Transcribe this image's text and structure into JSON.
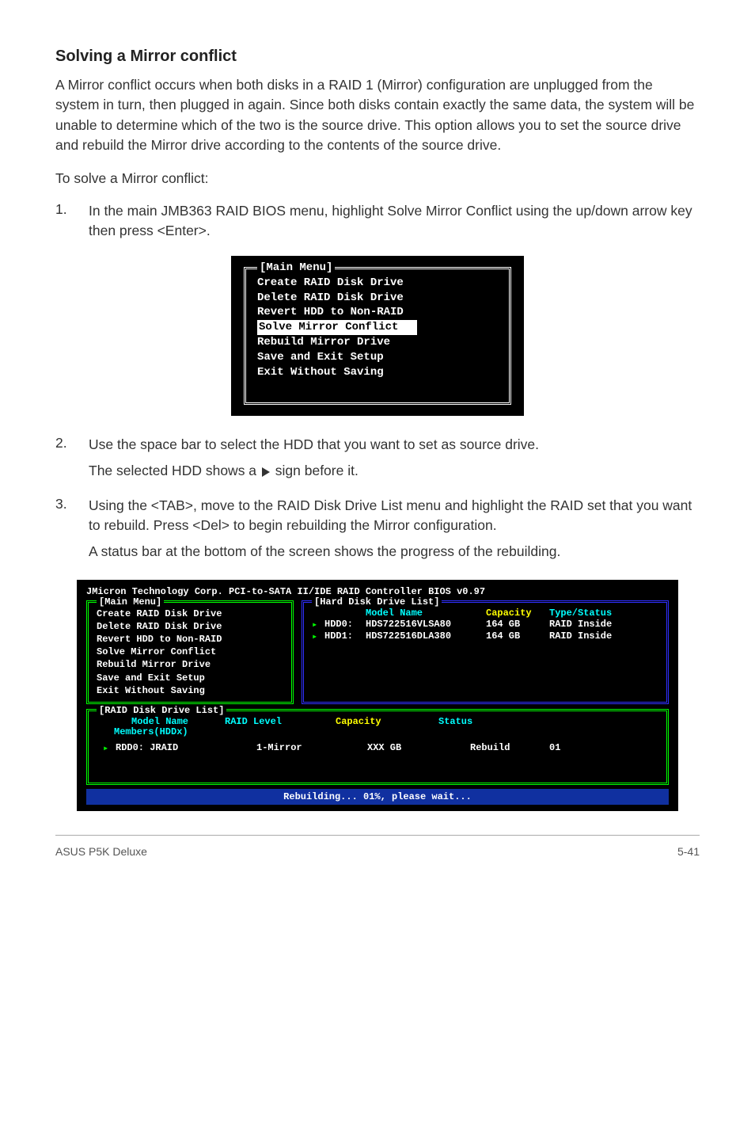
{
  "heading": "Solving a Mirror conflict",
  "para1": "A Mirror conflict occurs when both disks in a RAID 1 (Mirror) configuration are unplugged from the system in turn, then plugged in again. Since both disks contain exactly the same data, the system will be unable to determine which of the two is the source drive. This option allows you to set the source drive and rebuild the Mirror drive according to the contents of the source drive.",
  "para2": "To solve a Mirror conflict:",
  "step1_num": "1.",
  "step1_text": "In the main JMB363 RAID BIOS menu, highlight Solve Mirror Conflict using the up/down arrow key then press <Enter>.",
  "bios_small": {
    "title": "[Main Menu]",
    "items": [
      "Create RAID Disk Drive",
      "Delete RAID Disk Drive",
      "Revert HDD to Non-RAID",
      "Solve Mirror Conflict",
      "Rebuild Mirror Drive",
      "Save and Exit Setup",
      "Exit Without Saving"
    ],
    "highlight_index": 3
  },
  "step2_num": "2.",
  "step2_text": "Use the space bar to select the HDD that you want to set as source drive.",
  "step2_sub_before": "The selected HDD shows a ",
  "step2_sub_after": " sign before it.",
  "step3_num": "3.",
  "step3_text": "Using the <TAB>, move to the RAID Disk Drive List menu and highlight the RAID set that you want to rebuild. Press <Del> to begin rebuilding the Mirror configuration.",
  "step3_sub": "A status bar at the bottom of the screen shows the progress of the rebuilding.",
  "bios_large": {
    "header": "JMicron Technology Corp. PCI-to-SATA II/IDE RAID Controller BIOS v0.97",
    "main_menu_title": "[Main Menu]",
    "main_menu_items": [
      "Create RAID Disk Drive",
      "Delete RAID Disk Drive",
      "Revert HDD to Non-RAID",
      "Solve Mirror Conflict",
      "Rebuild Mirror Drive",
      "Save and Exit Setup",
      "Exit Without Saving"
    ],
    "hdd_list_title": "[Hard Disk Drive List]",
    "hdd_headers": {
      "model": "Model Name",
      "capacity": "Capacity",
      "type": "Type/Status"
    },
    "hdd_rows": [
      {
        "slot": "HDD0:",
        "model": "HDS722516VLSA80",
        "capacity": "164 GB",
        "type": "RAID Inside"
      },
      {
        "slot": "HDD1:",
        "model": "HDS722516DLA380",
        "capacity": "164 GB",
        "type": "RAID Inside"
      }
    ],
    "raid_list_title": "[RAID Disk Drive List]",
    "raid_headers": {
      "model": "Model Name",
      "level": "RAID Level",
      "capacity": "Capacity",
      "status": "Status"
    },
    "members_label": "Members(HDDx)",
    "raid_row": {
      "name": "RDD0:  JRAID",
      "level": "1-Mirror",
      "capacity": "XXX GB",
      "status": "Rebuild",
      "extra": "01"
    },
    "footer": "Rebuilding... 01%, please wait..."
  },
  "footer_left": "ASUS P5K Deluxe",
  "footer_right": "5-41"
}
